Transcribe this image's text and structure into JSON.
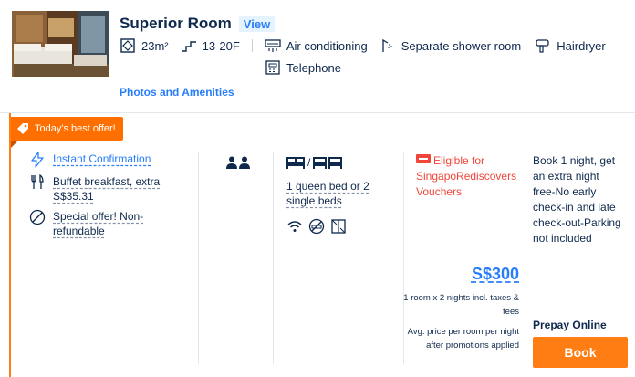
{
  "room": {
    "name": "Superior Room",
    "view_label": "View",
    "size": "23m²",
    "floor": "13-20F",
    "facilities": [
      "Air conditioning",
      "Separate shower room",
      "Hairdryer",
      "Telephone"
    ],
    "photos_link": "Photos and Amenities"
  },
  "rate": {
    "best_offer_label": "Today's best offer!",
    "perks": [
      {
        "icon": "lightning-icon",
        "text": "Instant Confirmation"
      },
      {
        "icon": "fork-knife-icon",
        "text": "Buffet breakfast, extra S$35.31"
      },
      {
        "icon": "no-entry-icon",
        "text": "Special offer! Non-refundable"
      }
    ],
    "guests_icon": "two-guests-icon",
    "bed_separator": "/",
    "bed_description": "1 queen bed or 2 single beds",
    "room_features": [
      "wifi-icon",
      "no-smoking-icon",
      "window-icon"
    ],
    "voucher_text": "Eligible for SingapoRediscovers Vouchers",
    "price": "S$300",
    "price_note_1": "1 room x 2 nights incl. taxes & fees",
    "price_note_2": "Avg. price per room per night after promotions applied",
    "policy_text": "Book 1 night, get an extra night free-No early check-in and late check-out-Parking not included",
    "payment_type": "Prepay Online",
    "book_label": "Book"
  },
  "colors": {
    "accent_orange": "#ff7d13",
    "link_blue": "#287dfa",
    "voucher_red": "#f0463a",
    "text_dark": "#0f294d"
  }
}
